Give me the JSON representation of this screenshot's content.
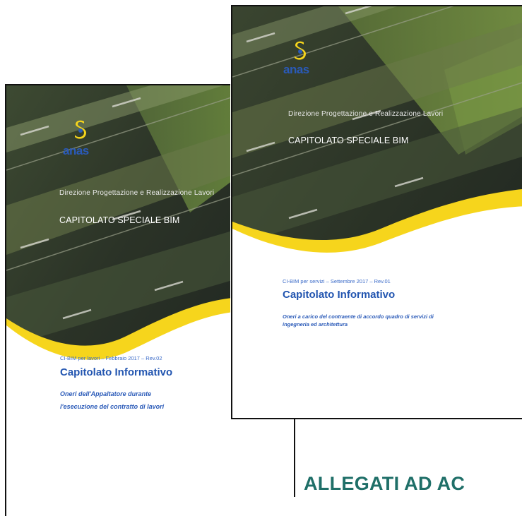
{
  "back_cover": {
    "logo_text": "anas",
    "department": "Direzione Progettazione e Realizzazione Lavori",
    "heading": "CAPITOLATO SPECIALE BIM",
    "meta": "CI-BIM per lavori – Febbraio 2017 – Rev.02",
    "title": "Capitolato Informativo",
    "subtitle_lines": [
      "Oneri dell'Appaltatore durante",
      "l'esecuzione del contratto di lavori"
    ]
  },
  "front_cover": {
    "logo_text": "anas",
    "department": "Direzione Progettazione e Realizzazione Lavori",
    "heading": "CAPITOLATO SPECIALE BIM",
    "meta": "CI-BIM per servizi – Settembre 2017 – Rev.01",
    "title": "Capitolato Informativo",
    "subtitle_lines": [
      "Oneri a carico del contraente di accordo quadro di servizi di",
      "ingegneria ed architettura"
    ]
  },
  "section_heading": "ALLEGATI AD AC",
  "colors": {
    "brand_yellow": "#f6d51c",
    "brand_blue": "#2a5ab8",
    "heading_teal": "#1f6f68"
  },
  "icons": [
    "anas-logo-icon"
  ]
}
